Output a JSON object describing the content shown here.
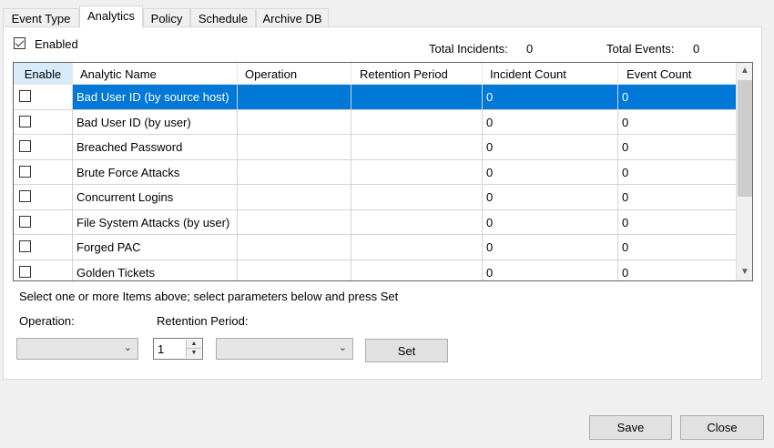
{
  "tabs": [
    {
      "label": "Event Type",
      "active": false
    },
    {
      "label": "Analytics",
      "active": true
    },
    {
      "label": "Policy",
      "active": false
    },
    {
      "label": "Schedule",
      "active": false
    },
    {
      "label": "Archive DB",
      "active": false
    }
  ],
  "enabled": {
    "label": "Enabled",
    "checked": true
  },
  "totals": {
    "incidents_label": "Total Incidents:",
    "incidents_value": "0",
    "events_label": "Total Events:",
    "events_value": "0"
  },
  "grid": {
    "columns": [
      "Enable",
      "Analytic Name",
      "Operation",
      "Retention Period",
      "Incident Count",
      "Event Count"
    ],
    "rows": [
      {
        "enable": false,
        "name": "Bad User ID (by source host)",
        "operation": "",
        "retention": "",
        "incident_count": "0",
        "event_count": "0",
        "selected": true
      },
      {
        "enable": false,
        "name": "Bad User ID (by user)",
        "operation": "",
        "retention": "",
        "incident_count": "0",
        "event_count": "0",
        "selected": false
      },
      {
        "enable": false,
        "name": "Breached Password",
        "operation": "",
        "retention": "",
        "incident_count": "0",
        "event_count": "0",
        "selected": false
      },
      {
        "enable": false,
        "name": "Brute Force Attacks",
        "operation": "",
        "retention": "",
        "incident_count": "0",
        "event_count": "0",
        "selected": false
      },
      {
        "enable": false,
        "name": "Concurrent Logins",
        "operation": "",
        "retention": "",
        "incident_count": "0",
        "event_count": "0",
        "selected": false
      },
      {
        "enable": false,
        "name": "File System Attacks (by user)",
        "operation": "",
        "retention": "",
        "incident_count": "0",
        "event_count": "0",
        "selected": false
      },
      {
        "enable": false,
        "name": "Forged PAC",
        "operation": "",
        "retention": "",
        "incident_count": "0",
        "event_count": "0",
        "selected": false
      },
      {
        "enable": false,
        "name": "Golden Tickets",
        "operation": "",
        "retention": "",
        "incident_count": "0",
        "event_count": "0",
        "selected": false
      }
    ]
  },
  "instructions": "Select one or more Items above; select parameters below and press Set",
  "operation": {
    "label": "Operation:",
    "value": ""
  },
  "retention": {
    "label": "Retention Period:",
    "number": "1",
    "unit": ""
  },
  "buttons": {
    "set": "Set",
    "save": "Save",
    "close": "Close"
  },
  "colors": {
    "selection": "#0078d7",
    "header_highlight": "#d9ebf9"
  },
  "icons": {
    "combo_arrow": "chevron-down-icon",
    "scroll_up": "chevron-up-icon",
    "scroll_down": "chevron-down-icon"
  }
}
